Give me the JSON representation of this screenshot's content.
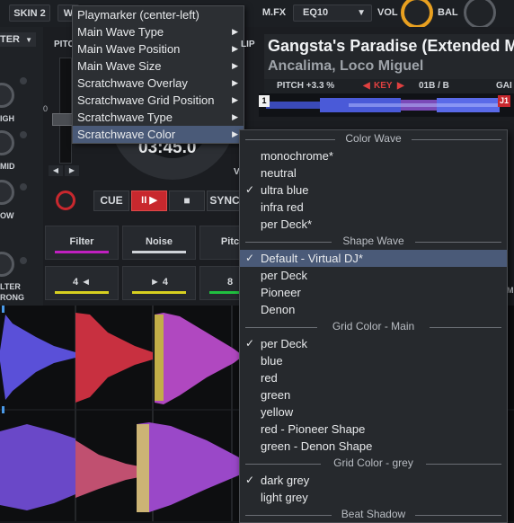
{
  "topbar": {
    "skin2": "SKIN 2",
    "w_btn": "W",
    "mfx": "M.FX",
    "eq_select": "EQ10",
    "vol": "VOL",
    "bal": "BAL"
  },
  "left_deck": {
    "filter_label": "TER",
    "pitch_label": "PITC",
    "side_labels": [
      "IGH",
      "MID",
      "OW",
      "LTER",
      "RONG"
    ],
    "time": "03:45.0",
    "v_label": "V",
    "cue": "CUE",
    "play": "II ▶",
    "stop": "■",
    "sync": "SYNC",
    "pads_top": [
      "Filter",
      "Noise",
      "Pitc"
    ],
    "pads_bottom": [
      "4  ◄",
      "►  4",
      "8"
    ],
    "zero_mark": "0"
  },
  "right_deck": {
    "lip": "LIP",
    "title": "Gangsta's Paradise (Extended M",
    "artist": "Ancalima, Loco Miguel",
    "pitch": "PITCH +3.3 %",
    "key": "KEY",
    "key_value": "01B / B",
    "gain": "GAI",
    "marker_1": "1",
    "marker_j1": "J1",
    "m_label": "M"
  },
  "menu1": {
    "items": [
      {
        "label": "Playmarker (center-left)",
        "arrow": false
      },
      {
        "label": "Main Wave Type",
        "arrow": true
      },
      {
        "label": "Main Wave Position",
        "arrow": true
      },
      {
        "label": "Main Wave Size",
        "arrow": true
      },
      {
        "label": "Scratchwave Overlay",
        "arrow": true
      },
      {
        "label": "Scratchwave Grid Position",
        "arrow": true
      },
      {
        "label": "Scratchwave Type",
        "arrow": true
      },
      {
        "label": "Scratchwave Color",
        "arrow": true
      }
    ],
    "arrow_glyph": "▶"
  },
  "menu2": {
    "sections": [
      {
        "title": "Color Wave",
        "items": [
          {
            "label": "monochrome*",
            "checked": false
          },
          {
            "label": "neutral",
            "checked": false
          },
          {
            "label": "ultra blue",
            "checked": true
          },
          {
            "label": "infra red",
            "checked": false
          },
          {
            "label": "per Deck*",
            "checked": false
          }
        ]
      },
      {
        "title": "Shape Wave",
        "items": [
          {
            "label": "Default - Virtual DJ*",
            "checked": true
          },
          {
            "label": "per Deck",
            "checked": false
          },
          {
            "label": "Pioneer",
            "checked": false
          },
          {
            "label": "Denon",
            "checked": false
          }
        ]
      },
      {
        "title": "Grid Color - Main",
        "items": [
          {
            "label": "per Deck",
            "checked": true
          },
          {
            "label": "blue",
            "checked": false
          },
          {
            "label": "red",
            "checked": false
          },
          {
            "label": "green",
            "checked": false
          },
          {
            "label": "yellow",
            "checked": false
          },
          {
            "label": "red - Pioneer Shape",
            "checked": false
          },
          {
            "label": "green - Denon Shape",
            "checked": false
          }
        ]
      },
      {
        "title": "Grid Color - grey",
        "items": [
          {
            "label": "dark grey",
            "checked": true
          },
          {
            "label": "light grey",
            "checked": false
          }
        ]
      },
      {
        "title": "Beat Shadow",
        "items": []
      }
    ],
    "check_glyph": "✓"
  },
  "colors": {
    "accent_orange": "#e8a020",
    "play_red": "#c8282e",
    "key_red": "#e04040",
    "pad_magenta": "#c020c0",
    "pad_yellow": "#d8d020",
    "pad_green": "#20c040",
    "menu_highlight": "#4a5a78"
  }
}
